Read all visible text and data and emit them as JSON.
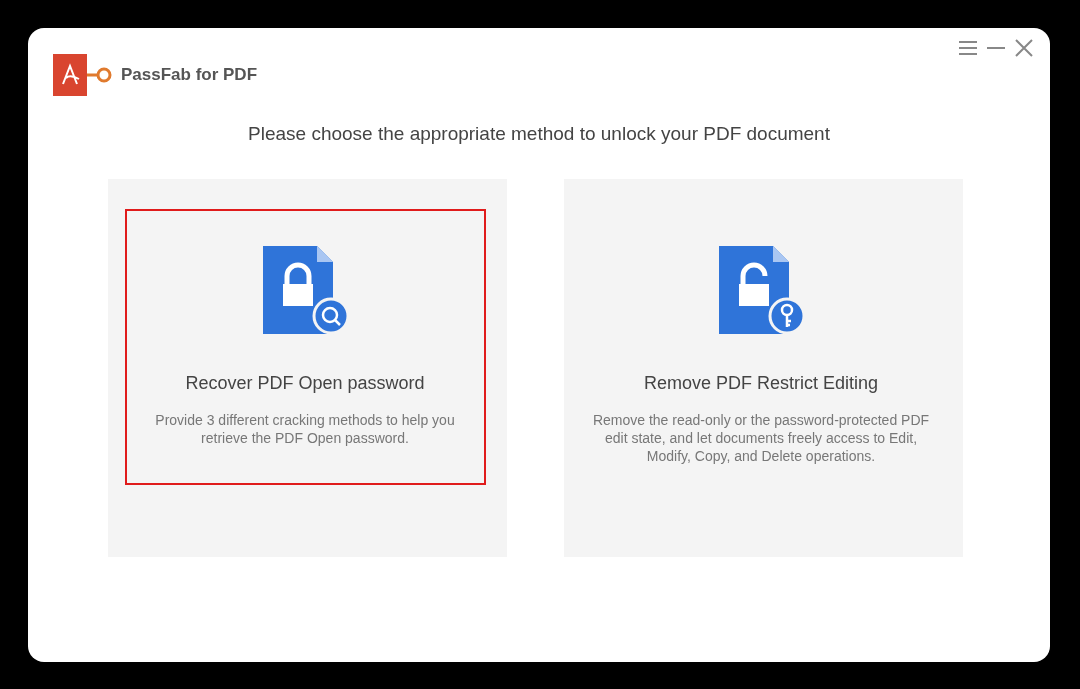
{
  "app": {
    "name": "PassFab for PDF"
  },
  "window_controls": [
    {
      "kind": "menu"
    },
    {
      "kind": "minimize"
    },
    {
      "kind": "close"
    }
  ],
  "heading": "Please choose the appropriate method to unlock your PDF document",
  "options": [
    {
      "kind": "recover",
      "title": "Recover PDF Open password",
      "description": "Provide 3 different cracking methods to help you retrieve the PDF Open password.",
      "selected": true
    },
    {
      "kind": "remove",
      "title": "Remove PDF Restrict Editing",
      "description": "Remove the read-only or the password-protected PDF edit state, and let documents freely access to Edit, Modify, Copy, and Delete operations.",
      "selected": false
    }
  ]
}
